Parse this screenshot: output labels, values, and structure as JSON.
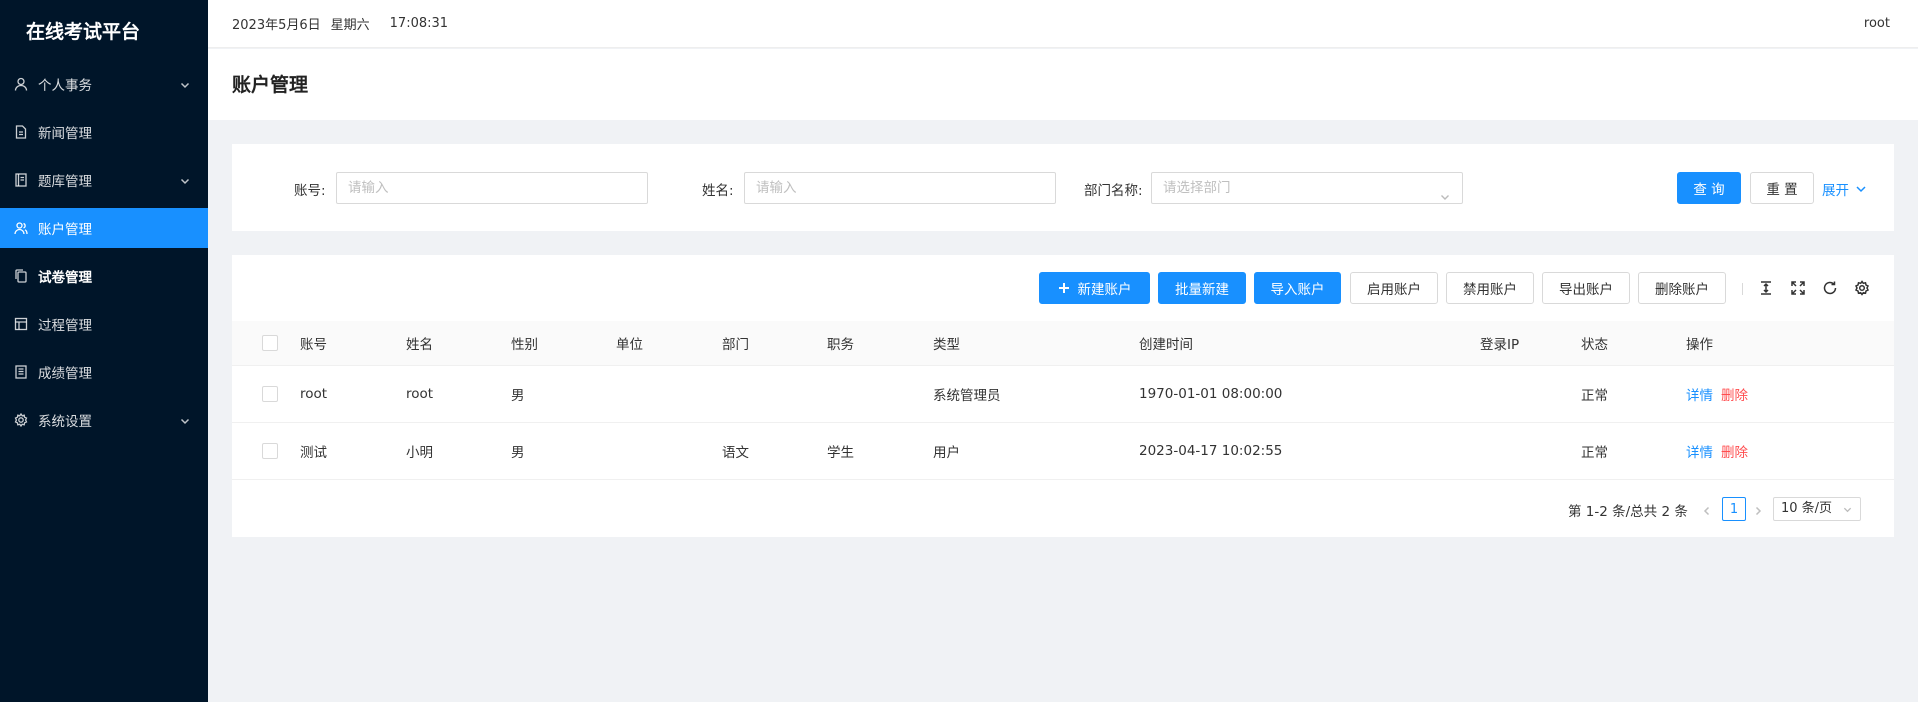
{
  "app": {
    "logo": "在线考试平台"
  },
  "header": {
    "date": "2023年5月6日",
    "weekday": "星期六",
    "time": "17:08:31",
    "user": "root"
  },
  "sidebar": {
    "items": [
      {
        "label": "个人事务",
        "icon": "user-icon",
        "has_submenu": true
      },
      {
        "label": "新闻管理",
        "icon": "file-icon",
        "has_submenu": false
      },
      {
        "label": "题库管理",
        "icon": "book-icon",
        "has_submenu": true
      },
      {
        "label": "账户管理",
        "icon": "team-icon",
        "has_submenu": false,
        "active": true
      },
      {
        "label": "试卷管理",
        "icon": "copy-icon",
        "has_submenu": false
      },
      {
        "label": "过程管理",
        "icon": "layout-icon",
        "has_submenu": false
      },
      {
        "label": "成绩管理",
        "icon": "reconciliation-icon",
        "has_submenu": false
      },
      {
        "label": "系统设置",
        "icon": "setting-icon",
        "has_submenu": true
      }
    ]
  },
  "page": {
    "title": "账户管理"
  },
  "search": {
    "account_label": "账号:",
    "account_placeholder": "请输入",
    "name_label": "姓名:",
    "name_placeholder": "请输入",
    "dept_label": "部门名称:",
    "dept_placeholder": "请选择部门",
    "query_label": "查 询",
    "reset_label": "重 置",
    "expand_label": "展开"
  },
  "toolbar": {
    "new_label": "新建账户",
    "batch_new_label": "批量新建",
    "import_label": "导入账户",
    "enable_label": "启用账户",
    "disable_label": "禁用账户",
    "export_label": "导出账户",
    "delete_label": "删除账户",
    "icons": [
      "column-height-icon",
      "fullscreen-icon",
      "reload-icon",
      "setting-icon"
    ]
  },
  "table": {
    "columns": [
      "账号",
      "姓名",
      "性别",
      "单位",
      "部门",
      "职务",
      "类型",
      "创建时间",
      "登录IP",
      "状态",
      "操作"
    ],
    "rows": [
      {
        "account": "root",
        "name": "root",
        "gender": "男",
        "unit": "",
        "dept": "",
        "position": "",
        "type": "系统管理员",
        "created": "1970-01-01 08:00:00",
        "ip": "",
        "status": "正常",
        "detail": "详情",
        "delete": "删除"
      },
      {
        "account": "测试",
        "name": "小明",
        "gender": "男",
        "unit": "",
        "dept": "语文",
        "position": "学生",
        "type": "用户",
        "created": "2023-04-17 10:02:55",
        "ip": "",
        "status": "正常",
        "detail": "详情",
        "delete": "删除"
      }
    ]
  },
  "pagination": {
    "total_text": "第 1-2 条/总共 2 条",
    "current_page": "1",
    "page_size": "10 条/页"
  },
  "colors": {
    "primary": "#1890ff",
    "sidebar_bg": "#001529",
    "danger": "#ff4d4f"
  }
}
